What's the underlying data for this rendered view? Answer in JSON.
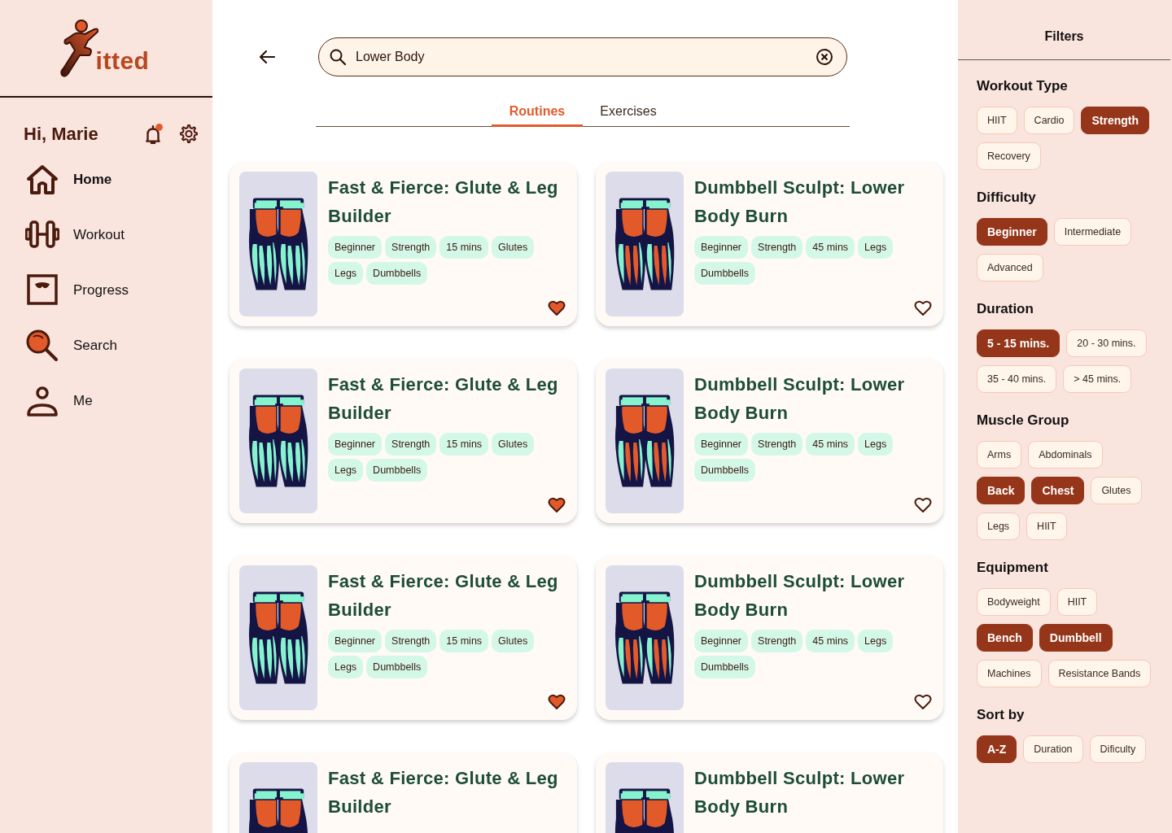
{
  "sidebar": {
    "logo_text": "itted",
    "greeting": "Hi, Marie",
    "has_notification": true,
    "items": [
      {
        "label": "Home",
        "selected": true
      },
      {
        "label": "Workout",
        "selected": false
      },
      {
        "label": "Progress",
        "selected": false
      },
      {
        "label": "Search",
        "selected": false
      },
      {
        "label": "Me",
        "selected": false
      }
    ]
  },
  "search": {
    "value": "Lower Body"
  },
  "tabs": [
    {
      "label": "Routines",
      "selected": true
    },
    {
      "label": "Exercises",
      "selected": false
    }
  ],
  "cards": [
    {
      "title": "Fast & Fierce: Glute & Leg Builder",
      "kind": "glutes",
      "favorite": true,
      "tags": [
        "Beginner",
        "Strength",
        "15 mins",
        "Glutes",
        "Legs",
        "Dumbbells"
      ]
    },
    {
      "title": "Dumbbell Sculpt: Lower Body Burn",
      "kind": "hamstrings",
      "favorite": false,
      "tags": [
        "Beginner",
        "Strength",
        "45 mins",
        "Legs",
        "Dumbbells"
      ]
    },
    {
      "title": "Fast & Fierce: Glute & Leg Builder",
      "kind": "glutes",
      "favorite": true,
      "tags": [
        "Beginner",
        "Strength",
        "15 mins",
        "Glutes",
        "Legs",
        "Dumbbells"
      ]
    },
    {
      "title": "Dumbbell Sculpt: Lower Body Burn",
      "kind": "hamstrings",
      "favorite": false,
      "tags": [
        "Beginner",
        "Strength",
        "45 mins",
        "Legs",
        "Dumbbells"
      ]
    },
    {
      "title": "Fast & Fierce: Glute & Leg Builder",
      "kind": "glutes",
      "favorite": true,
      "tags": [
        "Beginner",
        "Strength",
        "15 mins",
        "Glutes",
        "Legs",
        "Dumbbells"
      ]
    },
    {
      "title": "Dumbbell Sculpt: Lower Body Burn",
      "kind": "hamstrings",
      "favorite": false,
      "tags": [
        "Beginner",
        "Strength",
        "45 mins",
        "Legs",
        "Dumbbells"
      ]
    },
    {
      "title": "Fast & Fierce: Glute & Leg Builder",
      "kind": "glutes"
    },
    {
      "title": "Dumbbell Sculpt: Lower Body Burn",
      "kind": "hamstrings"
    }
  ],
  "filters": {
    "title": "Filters",
    "sections": [
      {
        "title": "Workout Type",
        "options": [
          {
            "label": "HIIT",
            "selected": false
          },
          {
            "label": "Cardio",
            "selected": false
          },
          {
            "label": "Strength",
            "selected": true
          },
          {
            "label": "Recovery",
            "selected": false
          }
        ]
      },
      {
        "title": "Difficulty",
        "options": [
          {
            "label": "Beginner",
            "selected": true
          },
          {
            "label": "Intermediate",
            "selected": false
          },
          {
            "label": "Advanced",
            "selected": false
          }
        ]
      },
      {
        "title": "Duration",
        "options": [
          {
            "label": "5 - 15 mins.",
            "selected": true
          },
          {
            "label": "20 - 30 mins.",
            "selected": false
          },
          {
            "label": "35 - 40 mins.",
            "selected": false
          },
          {
            "label": "> 45 mins.",
            "selected": false
          }
        ]
      },
      {
        "title": "Muscle Group",
        "options": [
          {
            "label": "Arms",
            "selected": false
          },
          {
            "label": "Abdominals",
            "selected": false
          },
          {
            "label": "Back",
            "selected": true
          },
          {
            "label": "Chest",
            "selected": true
          },
          {
            "label": "Glutes",
            "selected": false
          },
          {
            "label": "Legs",
            "selected": false
          },
          {
            "label": "HIIT",
            "selected": false
          }
        ]
      },
      {
        "title": "Equipment",
        "options": [
          {
            "label": "Bodyweight",
            "selected": false
          },
          {
            "label": "HIIT",
            "selected": false
          },
          {
            "label": "Bench",
            "selected": true
          },
          {
            "label": "Dumbbell",
            "selected": true
          },
          {
            "label": "Machines",
            "selected": false
          },
          {
            "label": "Resistance Bands",
            "selected": false
          }
        ]
      },
      {
        "title": "Sort by",
        "options": [
          {
            "label": "A-Z",
            "selected": true
          },
          {
            "label": "Duration",
            "selected": false
          },
          {
            "label": "Dificulty",
            "selected": false
          }
        ]
      }
    ]
  }
}
